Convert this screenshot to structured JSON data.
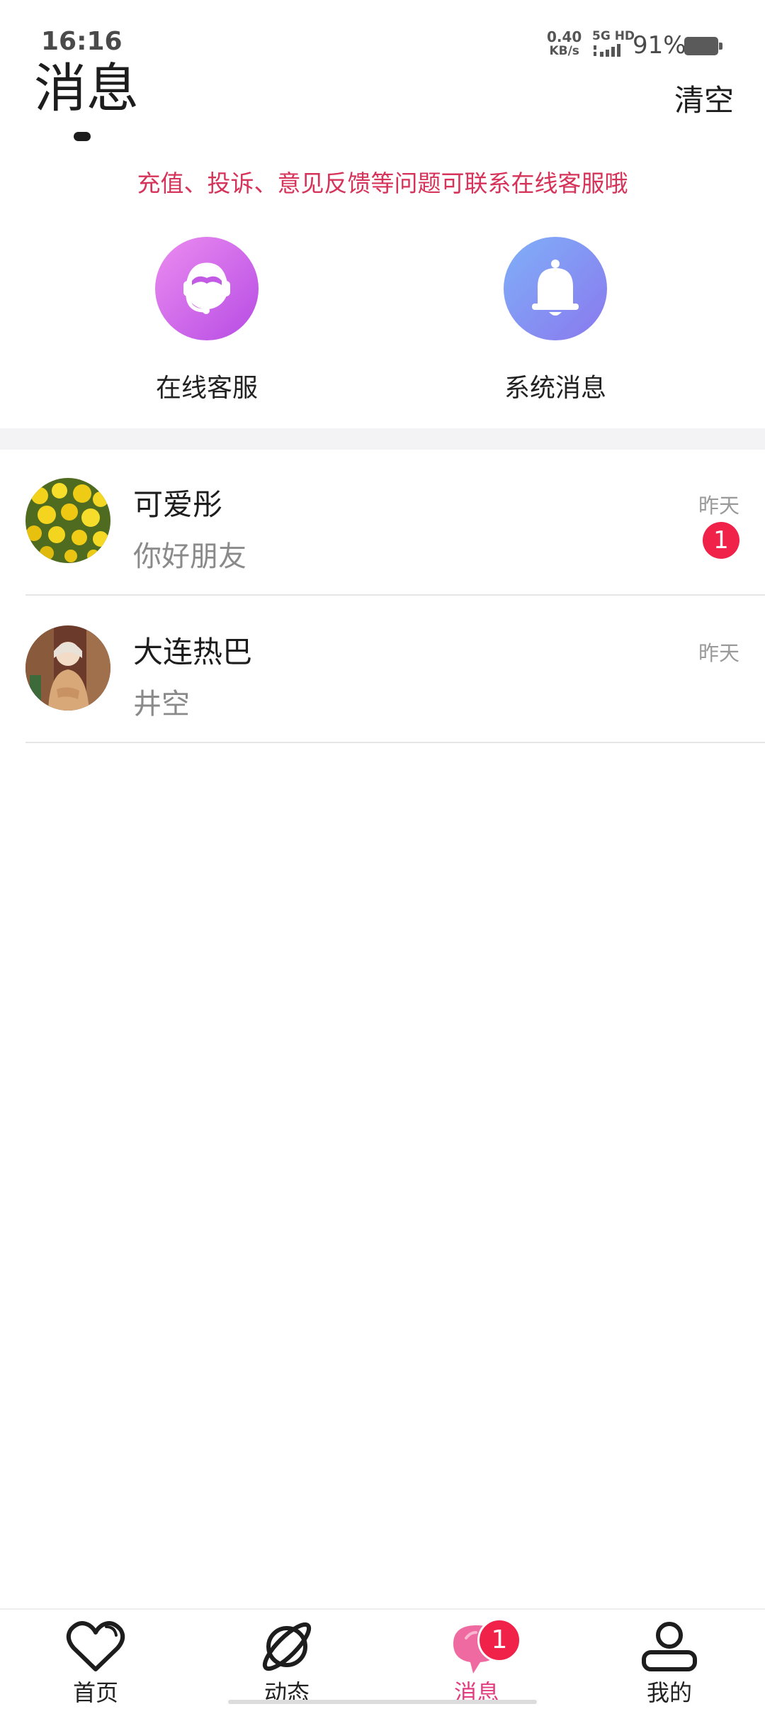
{
  "status_bar": {
    "time": "16:16",
    "net_speed_value": "0.40",
    "net_speed_unit": "KB/s",
    "network": "5G HD",
    "battery": "91%"
  },
  "header": {
    "title": "消息",
    "clear_label": "清空"
  },
  "notice": "充值、投诉、意见反馈等问题可联系在线客服哦",
  "quick_entries": [
    {
      "label": "在线客服",
      "icon": "headset-icon"
    },
    {
      "label": "系统消息",
      "icon": "bell-icon"
    }
  ],
  "conversations": [
    {
      "name": "可爱彤",
      "preview": "你好朋友",
      "time": "昨天",
      "unread": "1",
      "avatar": "flowers-avatar"
    },
    {
      "name": "大连热巴",
      "preview": "井空",
      "time": "昨天",
      "unread": "",
      "avatar": "person-avatar"
    }
  ],
  "bottom_nav": {
    "items": [
      {
        "label": "首页",
        "icon": "heart-icon"
      },
      {
        "label": "动态",
        "icon": "planet-icon"
      },
      {
        "label": "消息",
        "icon": "chat-bubble-icon",
        "badge": "1",
        "active": true
      },
      {
        "label": "我的",
        "icon": "user-icon"
      }
    ]
  },
  "colors": {
    "accent": "#e23b7f",
    "notice": "#d6335a",
    "badge": "#f02249"
  }
}
